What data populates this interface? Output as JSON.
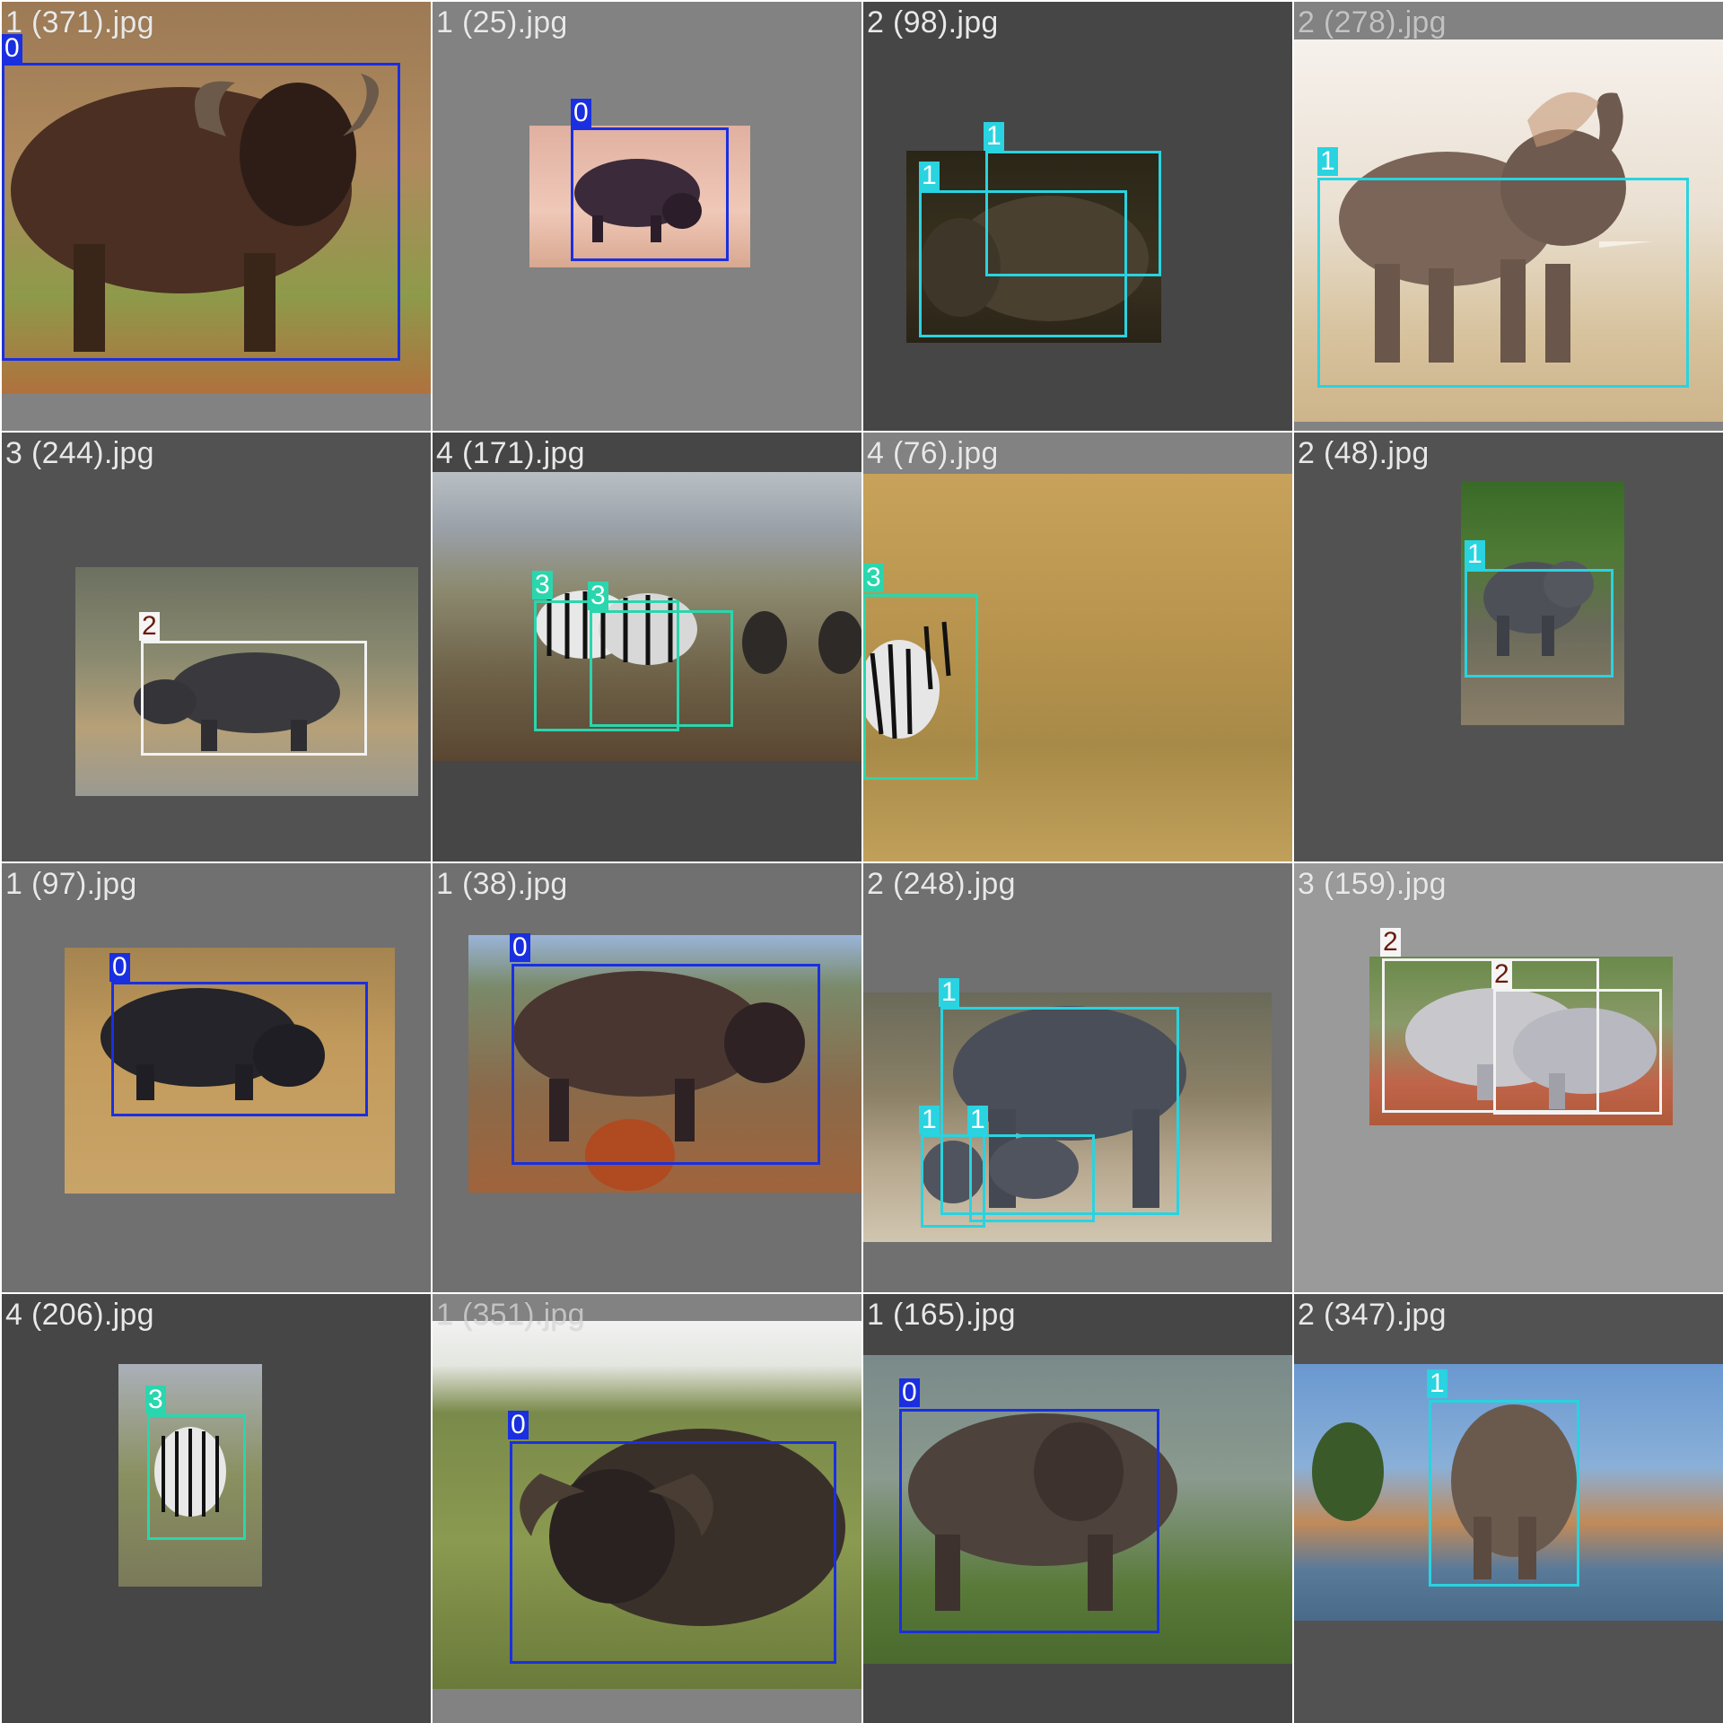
{
  "tiles": [
    {
      "file": "1 (371).jpg",
      "labels": [
        "0"
      ]
    },
    {
      "file": "1 (25).jpg",
      "labels": [
        "0"
      ]
    },
    {
      "file": "2 (98).jpg",
      "labels": [
        "1",
        "1"
      ]
    },
    {
      "file": "2 (278).jpg",
      "labels": [
        "1"
      ]
    },
    {
      "file": "3 (244).jpg",
      "labels": [
        "2"
      ]
    },
    {
      "file": "4 (171).jpg",
      "labels": [
        "3",
        "3"
      ]
    },
    {
      "file": "4 (76).jpg",
      "labels": [
        "3"
      ]
    },
    {
      "file": "2 (48).jpg",
      "labels": [
        "1"
      ]
    },
    {
      "file": "1 (97).jpg",
      "labels": [
        "0"
      ]
    },
    {
      "file": "1 (38).jpg",
      "labels": [
        "0"
      ]
    },
    {
      "file": "2 (248).jpg",
      "labels": [
        "1",
        "1",
        "1"
      ]
    },
    {
      "file": "3 (159).jpg",
      "labels": [
        "2",
        "2"
      ]
    },
    {
      "file": "4 (206).jpg",
      "labels": [
        "3"
      ]
    },
    {
      "file": "1 (351).jpg",
      "labels": [
        "0"
      ]
    },
    {
      "file": "1 (165).jpg",
      "labels": [
        "0"
      ]
    },
    {
      "file": "2 (347).jpg",
      "labels": [
        "1"
      ]
    }
  ],
  "class_colors": {
    "0": "#1a2fe0",
    "1": "#29d3e0",
    "2": "#f2f2f2",
    "3": "#2ad6ad"
  }
}
